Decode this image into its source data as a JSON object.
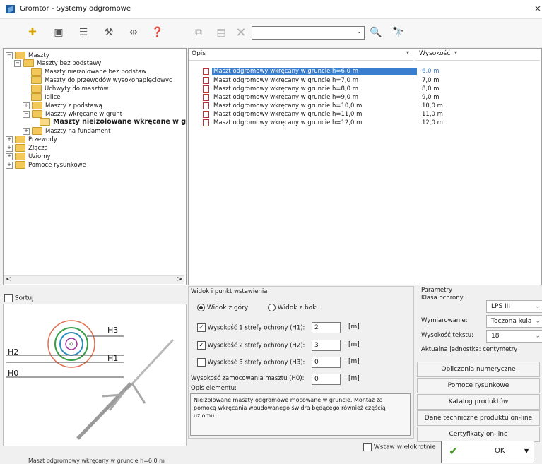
{
  "window": {
    "title": "Gromtor - Systemy odgromowe",
    "close": "×"
  },
  "toolbar": {
    "icons": [
      "add-icon",
      "view-icon",
      "list-icon",
      "tool-icon",
      "measure-icon",
      "help-icon",
      "copy-icon",
      "properties-icon",
      "delete-icon"
    ],
    "search_value": "",
    "search_icon": "🔍",
    "binoculars_icon": "🔭"
  },
  "tree": {
    "items": [
      {
        "label": "Maszty",
        "pm": "−"
      },
      {
        "label": "Maszty bez podstawy",
        "pm": "−"
      },
      {
        "label": "Maszty nieizolowane bez podstaw"
      },
      {
        "label": "Maszty do przewodów wysokonapięciowyc"
      },
      {
        "label": "Uchwyty do masztów"
      },
      {
        "label": "Iglice"
      },
      {
        "label": "Maszty z podstawą",
        "pm": "+"
      },
      {
        "label": "Maszty wkręcane w grunt",
        "pm": "−"
      },
      {
        "label": "Maszty nieizolowane wkręcane w gr"
      },
      {
        "label": "Maszty na fundament",
        "pm": "+"
      },
      {
        "label": "Przewody",
        "pm": "+"
      },
      {
        "label": "Złącza",
        "pm": "+"
      },
      {
        "label": "Uziomy",
        "pm": "+"
      },
      {
        "label": "Pomoce rysunkowe",
        "pm": "+"
      }
    ],
    "scroll_left": "<",
    "scroll_right": ">"
  },
  "list": {
    "col_opis": "Opis",
    "col_wys": "Wysokość",
    "rows": [
      {
        "opis": "Maszt odgromowy wkręcany w gruncie h=6,0 m",
        "wys": "6,0 m"
      },
      {
        "opis": "Maszt odgromowy wkręcany w gruncie h=7,0 m",
        "wys": "7,0 m"
      },
      {
        "opis": "Maszt odgromowy wkręcany w gruncie h=8,0 m",
        "wys": "8,0 m"
      },
      {
        "opis": "Maszt odgromowy wkręcany w gruncie h=9,0 m",
        "wys": "9,0 m"
      },
      {
        "opis": "Maszt odgromowy wkręcany w gruncie h=10,0 m",
        "wys": "10,0 m"
      },
      {
        "opis": "Maszt odgromowy wkręcany w gruncie h=11,0 m",
        "wys": "11,0 m"
      },
      {
        "opis": "Maszt odgromowy wkręcany w gruncie h=12,0 m",
        "wys": "12,0 m"
      }
    ],
    "selected_index": 0
  },
  "sort": {
    "label": "Sortuj",
    "checked": false
  },
  "preview": {
    "labels": [
      "H3",
      "H2",
      "H1",
      "H0"
    ],
    "caption": "Maszt odgromowy wkręcany w gruncie h=6,0 m"
  },
  "options": {
    "group_label": "Widok i punkt wstawienia",
    "radio_top": "Widok z góry",
    "radio_side": "Widok z boku",
    "h1_label": "Wysokość 1 strefy ochrony (H1):",
    "h1_value": "2",
    "h2_label": "Wysokość 2 strefy ochrony (H2):",
    "h2_value": "3",
    "h3_label": "Wysokość 3 strefy ochrony (H3):",
    "h3_value": "0",
    "h0_label": "Wysokość zamocowania masztu (H0):",
    "h0_value": "0",
    "unit": "[m]",
    "desc_label": "Opis elementu:",
    "desc_text": "Nieizolowane maszty odgromowe mocowane w gruncie. Montaż za pomocą wkręcania wbudowanego świdra będącego również częścią uziomu."
  },
  "params": {
    "group_label": "Parametry",
    "klasa_label": "Klasa ochrony:",
    "klasa_value": "LPS III",
    "wym_label": "Wymiarowanie:",
    "wym_value": "Toczona kula",
    "wys_tekstu_label": "Wysokość tekstu:",
    "wys_tekstu_value": "18",
    "unit_text": "Aktualna jednostka: centymetry",
    "btn_obliczenia": "Obliczenia numeryczne",
    "btn_pomoce": "Pomoce rysunkowe",
    "btn_katalog": "Katalog produktów",
    "btn_dane": "Dane techniczne produktu on-line",
    "btn_certyfikaty": "Certyfikaty on-line"
  },
  "footer": {
    "multi_label": "Wstaw wielokrotnie",
    "ok_label": "OK",
    "check_icon": "✔",
    "arrow": "▼"
  },
  "colors": {
    "selection": "#3a7fcf",
    "folder": "#f3c85a",
    "check": "#4a9a2a"
  }
}
